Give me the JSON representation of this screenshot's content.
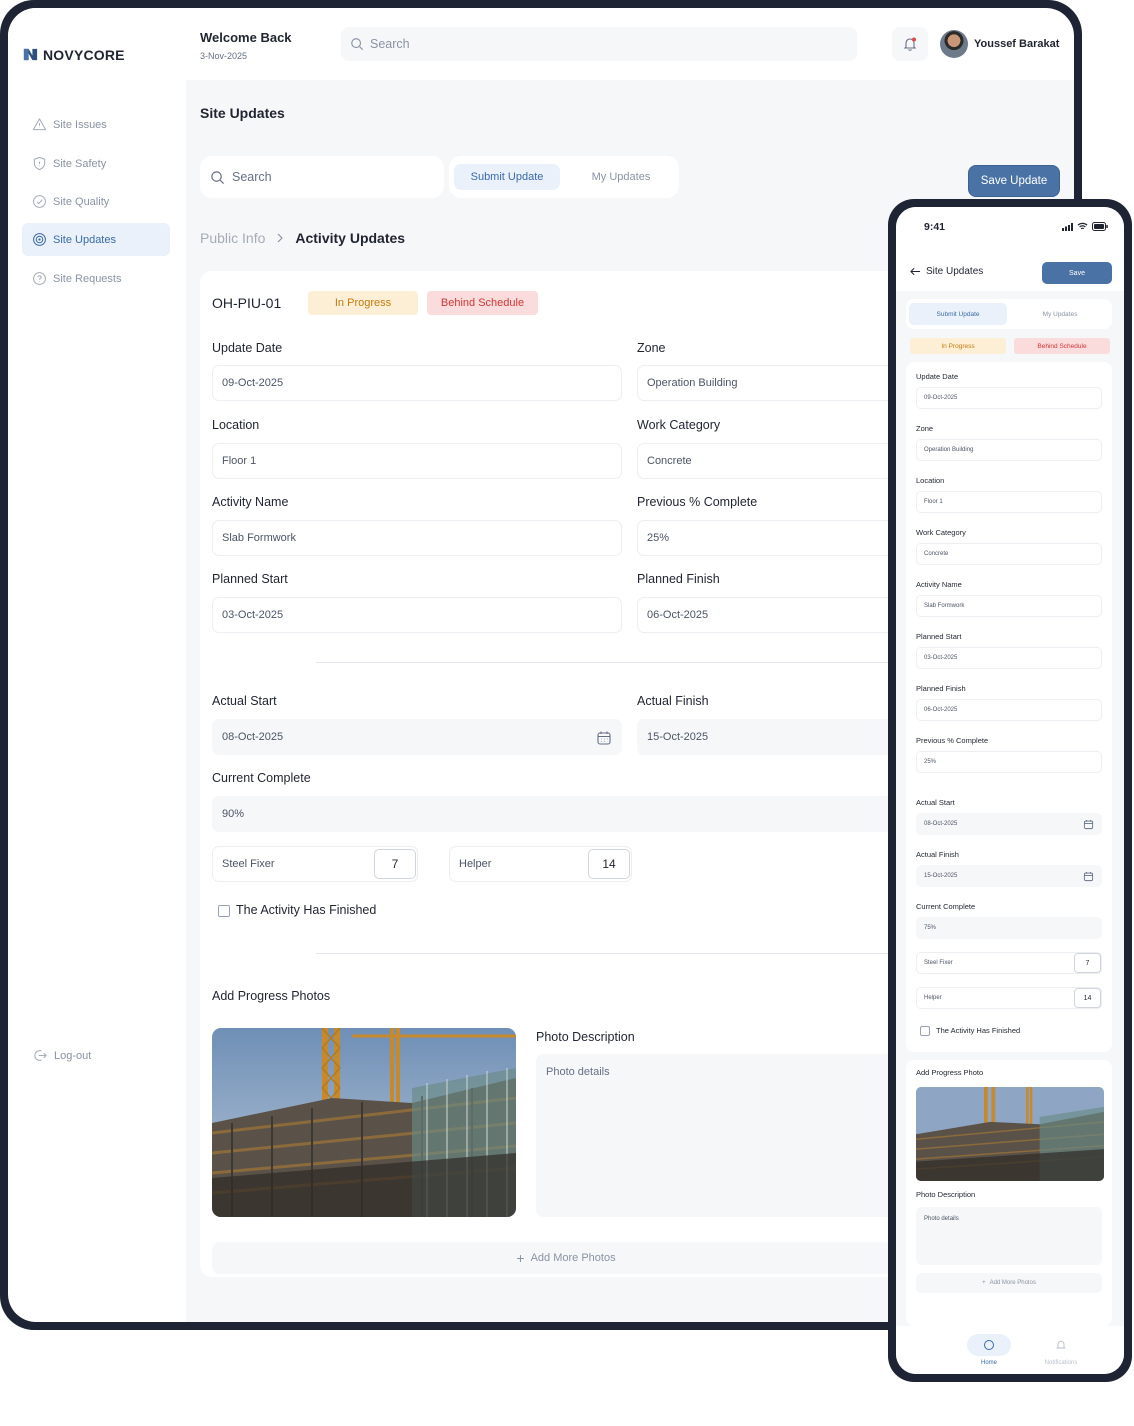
{
  "brand": {
    "name": "NOVYCORE"
  },
  "sidebar": {
    "items": [
      {
        "label": "Site Issues",
        "icon": "alert-triangle-icon"
      },
      {
        "label": "Site Safety",
        "icon": "shield-icon"
      },
      {
        "label": "Site Quality",
        "icon": "check-circle-icon"
      },
      {
        "label": "Site Updates",
        "icon": "target-icon",
        "active": true
      },
      {
        "label": "Site Requests",
        "icon": "question-circle-icon"
      }
    ],
    "logout": "Log-out"
  },
  "header": {
    "welcome": "Welcome Back",
    "date": "3-Nov-2025",
    "search_placeholder": "Search",
    "user_name": "Youssef Barakat"
  },
  "page": {
    "title": "Site Updates",
    "search_placeholder": "Search",
    "tabs": [
      "Submit Update",
      "My Updates"
    ],
    "save_button": "Save Update",
    "breadcrumb": [
      "Public Info",
      "Activity Updates"
    ]
  },
  "form": {
    "id": "OH-PIU-01",
    "status_badges": [
      "In Progress",
      "Behind Schedule"
    ],
    "fields": {
      "update_date": {
        "label": "Update Date",
        "value": "09-Oct-2025"
      },
      "zone": {
        "label": "Zone",
        "value": "Operation Building"
      },
      "location": {
        "label": "Location",
        "value": "Floor 1"
      },
      "work_category": {
        "label": "Work Category",
        "value": "Concrete"
      },
      "activity_name": {
        "label": "Activity Name",
        "value": "Slab Formwork"
      },
      "previous_complete": {
        "label": "Previous % Complete",
        "value": "25%"
      },
      "planned_start": {
        "label": "Planned Start",
        "value": "03-Oct-2025"
      },
      "planned_finish": {
        "label": "Planned Finish",
        "value": "06-Oct-2025"
      },
      "actual_start": {
        "label": "Actual Start",
        "value": "08-Oct-2025"
      },
      "actual_finish": {
        "label": "Actual Finish",
        "value": "15-Oct-2025"
      },
      "current_complete": {
        "label": "Current Complete",
        "value": "90%"
      }
    },
    "workers": [
      {
        "role": "Steel Fixer",
        "count": "7"
      },
      {
        "role": "Helper",
        "count": "14"
      }
    ],
    "finished_checkbox": "The Activity Has Finished",
    "photos_title": "Add Progress Photos",
    "photo_description_label": "Photo Description",
    "photo_description_placeholder": "Photo details",
    "add_more": "Add More Photos"
  },
  "mobile": {
    "time": "9:41",
    "title": "Site Updates",
    "save": "Save",
    "tabs": [
      "Submit Update",
      "My Updates"
    ],
    "badges": [
      "In Progress",
      "Behind Schedule"
    ],
    "fields": [
      {
        "label": "Update Date",
        "value": "09-Oct-2025"
      },
      {
        "label": "Zone",
        "value": "Operation Building"
      },
      {
        "label": "Location",
        "value": "Floor 1"
      },
      {
        "label": "Work Category",
        "value": "Concrete"
      },
      {
        "label": "Activity Name",
        "value": "Slab Formwork"
      },
      {
        "label": "Planned Start",
        "value": "03-Oct-2025"
      },
      {
        "label": "Planned Finish",
        "value": "06-Oct-2025"
      },
      {
        "label": "Previous % Complete",
        "value": "25%"
      }
    ],
    "actual_start": {
      "label": "Actual Start",
      "value": "08-Oct-2025"
    },
    "actual_finish": {
      "label": "Actual Finish",
      "value": "15-Oct-2025"
    },
    "current_complete": {
      "label": "Current Complete",
      "value": "75%"
    },
    "workers": [
      {
        "role": "Steel Fixer",
        "count": "7"
      },
      {
        "role": "Helper",
        "count": "14"
      }
    ],
    "finished_checkbox": "The Activity Has Finished",
    "photo_title": "Add Progress Photo",
    "photo_description_label": "Photo Description",
    "photo_description_placeholder": "Photo details",
    "add_more": "Add More Photos",
    "nav": [
      "Home",
      "Notifications"
    ]
  },
  "colors": {
    "accent": "#4a72a4",
    "active_bg": "#eaf1fb",
    "frame": "#1e2433",
    "badge_progress": "#fdefd5",
    "badge_behind": "#fbdcdc"
  }
}
